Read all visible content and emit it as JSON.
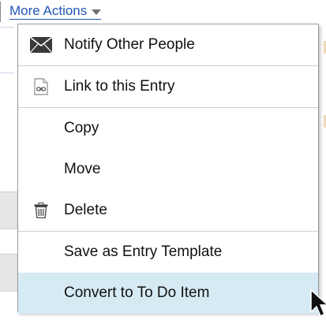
{
  "trigger": {
    "label": "More Actions"
  },
  "menu": {
    "items": [
      {
        "label": "Notify Other People",
        "icon": "envelope-icon"
      },
      {
        "label": "Link to this Entry",
        "icon": "link-document-icon"
      },
      {
        "label": "Copy",
        "icon": ""
      },
      {
        "label": "Move",
        "icon": ""
      },
      {
        "label": "Delete",
        "icon": "trash-icon"
      },
      {
        "label": "Save as Entry Template",
        "icon": ""
      },
      {
        "label": "Convert to To Do Item",
        "icon": "",
        "highlighted": true
      }
    ]
  },
  "colors": {
    "link": "#1f56b3",
    "highlight": "#d6eaf3",
    "menu_border": "#9b9b9b"
  }
}
